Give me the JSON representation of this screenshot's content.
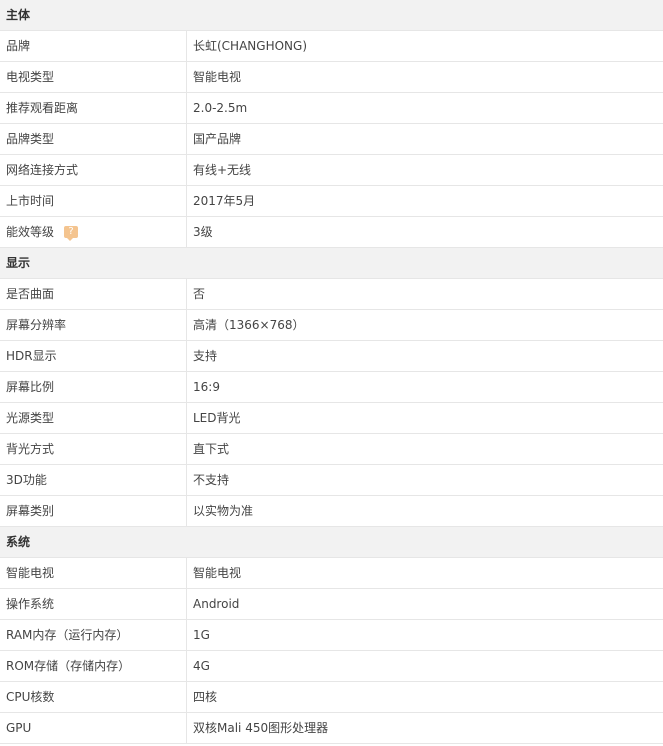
{
  "sections": [
    {
      "title": "主体",
      "rows": [
        {
          "label": "品牌",
          "value": "长虹(CHANGHONG)"
        },
        {
          "label": "电视类型",
          "value": "智能电视"
        },
        {
          "label": "推荐观看距离",
          "value": "2.0-2.5m"
        },
        {
          "label": "品牌类型",
          "value": "国产品牌"
        },
        {
          "label": "网络连接方式",
          "value": "有线+无线"
        },
        {
          "label": "上市时间",
          "value": "2017年5月"
        },
        {
          "label": "能效等级",
          "value": "3级",
          "help_icon": "question-bubble-icon"
        }
      ]
    },
    {
      "title": "显示",
      "rows": [
        {
          "label": "是否曲面",
          "value": "否"
        },
        {
          "label": "屏幕分辨率",
          "value": "高清（1366×768）"
        },
        {
          "label": "HDR显示",
          "value": "支持"
        },
        {
          "label": "屏幕比例",
          "value": "16:9"
        },
        {
          "label": "光源类型",
          "value": "LED背光"
        },
        {
          "label": "背光方式",
          "value": "直下式"
        },
        {
          "label": "3D功能",
          "value": "不支持"
        },
        {
          "label": "屏幕类别",
          "value": "以实物为准"
        }
      ]
    },
    {
      "title": "系统",
      "rows": [
        {
          "label": "智能电视",
          "value": "智能电视"
        },
        {
          "label": "操作系统",
          "value": "Android"
        },
        {
          "label": "RAM内存（运行内存）",
          "value": "1G"
        },
        {
          "label": "ROM存储（存储内存）",
          "value": "4G"
        },
        {
          "label": "CPU核数",
          "value": "四核"
        },
        {
          "label": "GPU",
          "value": "双核Mali 450图形处理器"
        }
      ]
    }
  ],
  "colors": {
    "section_bg": "#f2f2f2",
    "border": "#e6e6e6",
    "help_icon": "#f4c48f"
  }
}
